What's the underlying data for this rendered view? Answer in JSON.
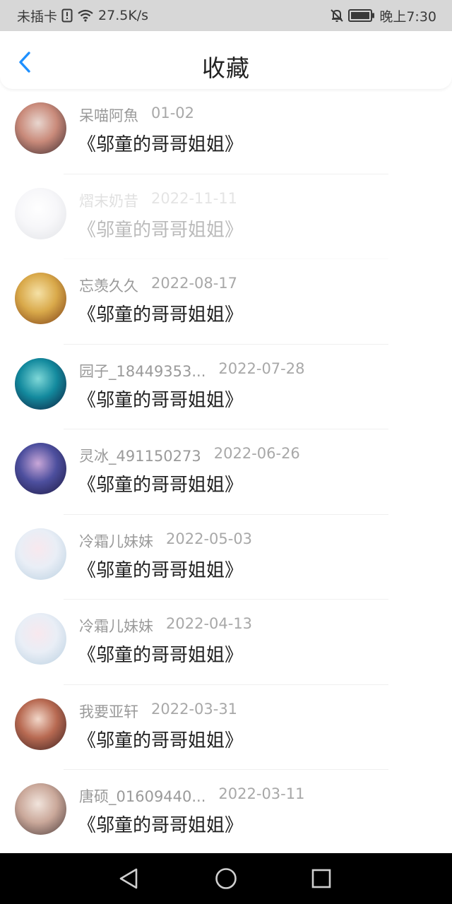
{
  "status_bar": {
    "carrier": "未插卡",
    "speed": "27.5K/s",
    "time": "晚上7:30",
    "icons": [
      "sim-alert-icon",
      "wifi-icon",
      "mute-bell-icon",
      "battery-icon"
    ]
  },
  "header": {
    "title": "收藏",
    "back_icon": "chevron-left-icon",
    "accent": "#1e90ff"
  },
  "items": [
    {
      "name": "呆喵阿魚",
      "date": "01-02",
      "book": "《邬童的哥哥姐姐》",
      "faded": false,
      "avatar_colors": [
        "#3a2a2e",
        "#c98a7a",
        "#e8d6cf"
      ]
    },
    {
      "name": "熠末奶昔",
      "date": "2022-11-11",
      "book": "《邬童的哥哥姐姐》",
      "faded": true,
      "avatar_colors": [
        "#9aa0ad",
        "#e6e6ee",
        "#ffffff"
      ]
    },
    {
      "name": "忘羡久久",
      "date": "2022-08-17",
      "book": "《邬童的哥哥姐姐》",
      "faded": false,
      "avatar_colors": [
        "#7a3c14",
        "#d9a94a",
        "#f5e1a6"
      ]
    },
    {
      "name": "园子_18449353...",
      "date": "2022-07-28",
      "book": "《邬童的哥哥姐姐》",
      "faded": false,
      "avatar_colors": [
        "#0d1a3a",
        "#138a9e",
        "#7fd8d8"
      ]
    },
    {
      "name": "灵冰_491150273",
      "date": "2022-06-26",
      "book": "《邬童的哥哥姐姐》",
      "faded": false,
      "avatar_colors": [
        "#1b1740",
        "#4d4f9e",
        "#c9a7d8"
      ]
    },
    {
      "name": "冷霜儿妹妹",
      "date": "2022-05-03",
      "book": "《邬童的哥哥姐姐》",
      "faded": false,
      "avatar_colors": [
        "#b8cfe0",
        "#e9eef6",
        "#f8e8ee"
      ]
    },
    {
      "name": "冷霜儿妹妹",
      "date": "2022-04-13",
      "book": "《邬童的哥哥姐姐》",
      "faded": false,
      "avatar_colors": [
        "#b8cfe0",
        "#e9eef6",
        "#f8e8ee"
      ]
    },
    {
      "name": "我要亚轩",
      "date": "2022-03-31",
      "book": "《邬童的哥哥姐姐》",
      "faded": false,
      "avatar_colors": [
        "#3a1f1f",
        "#b86a52",
        "#f2d7c9"
      ]
    },
    {
      "name": "唐硕_01609440...",
      "date": "2022-03-11",
      "book": "《邬童的哥哥姐姐》",
      "faded": false,
      "avatar_colors": [
        "#4a3a3a",
        "#caa89a",
        "#f1e4dc"
      ]
    }
  ],
  "nav_bar": {
    "buttons": [
      "back-triangle-icon",
      "home-circle-icon",
      "recents-square-icon"
    ]
  }
}
